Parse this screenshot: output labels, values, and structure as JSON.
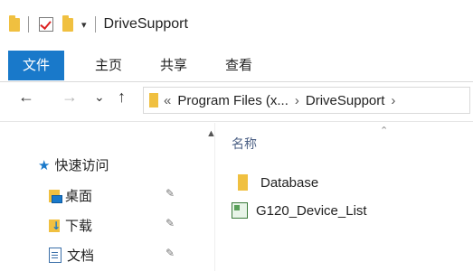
{
  "window": {
    "title": "DriveSupport",
    "qat_dropdown": "▾"
  },
  "ribbon": {
    "tabs": [
      {
        "label": "文件"
      },
      {
        "label": "主页"
      },
      {
        "label": "共享"
      },
      {
        "label": "查看"
      }
    ]
  },
  "address_bar": {
    "back": "←",
    "forward": "→",
    "recent": "⌄",
    "up": "↑",
    "overflow": "«",
    "crumbs": [
      "Program Files (x...",
      "DriveSupport"
    ],
    "separator": "›"
  },
  "nav_pane": {
    "quick_access": "快速访问",
    "items": [
      {
        "label": "桌面",
        "icon": "desktop-icon",
        "pinned": true
      },
      {
        "label": "下载",
        "icon": "downloads-icon",
        "pinned": true
      },
      {
        "label": "文档",
        "icon": "documents-icon",
        "pinned": true
      }
    ],
    "pin_glyph": "📌"
  },
  "content": {
    "column_header": "名称",
    "files": [
      {
        "name": "Database",
        "icon": "folder-icon"
      },
      {
        "name": "G120_Device_List",
        "icon": "device-list-icon"
      }
    ]
  },
  "colors": {
    "accent": "#1979ca",
    "folder": "#f0c040"
  }
}
